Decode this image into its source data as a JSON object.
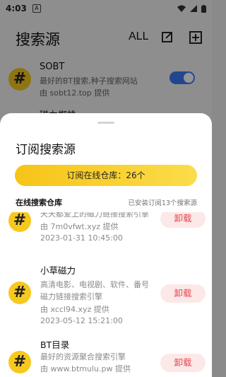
{
  "status_bar": {
    "time": "4:03",
    "badge": "A"
  },
  "header": {
    "title": "搜索源",
    "all_label": "ALL"
  },
  "background_sources": [
    {
      "name": "SOBT",
      "desc": "最好的BT搜索,种子搜索网站",
      "provider": "由 sobt12.top 提供",
      "enabled": true
    },
    {
      "name": "磁力蜘蛛"
    }
  ],
  "sheet": {
    "title": "订阅搜索源",
    "subscribe_button": "订阅在线仓库：26个",
    "section_label": "在线搜索仓库",
    "section_note": "已安装订阅13个搜索源",
    "items": [
      {
        "desc": "天天都爱上的磁力链接搜索引擎",
        "provider": "由 7m0vfwt.xyz 提供",
        "date": "2023-01-31 10:45:00",
        "action": "卸载"
      },
      {
        "name": "小草磁力",
        "desc1": "高清电影、电视剧、软件、番号",
        "desc2": "磁力链接搜索引擎",
        "provider": "由 xccl94.xyz 提供",
        "date": "2023-05-12 15:21:00",
        "action": "卸载"
      },
      {
        "name": "BT目录",
        "desc": "最好的资源聚合搜索引擎",
        "provider": "由 www.btmulu.pw 提供",
        "action": "卸载"
      }
    ]
  },
  "colors": {
    "accent_yellow": "#f7c81d",
    "toggle_blue": "#3a7cf4",
    "danger": "#e2484d"
  }
}
